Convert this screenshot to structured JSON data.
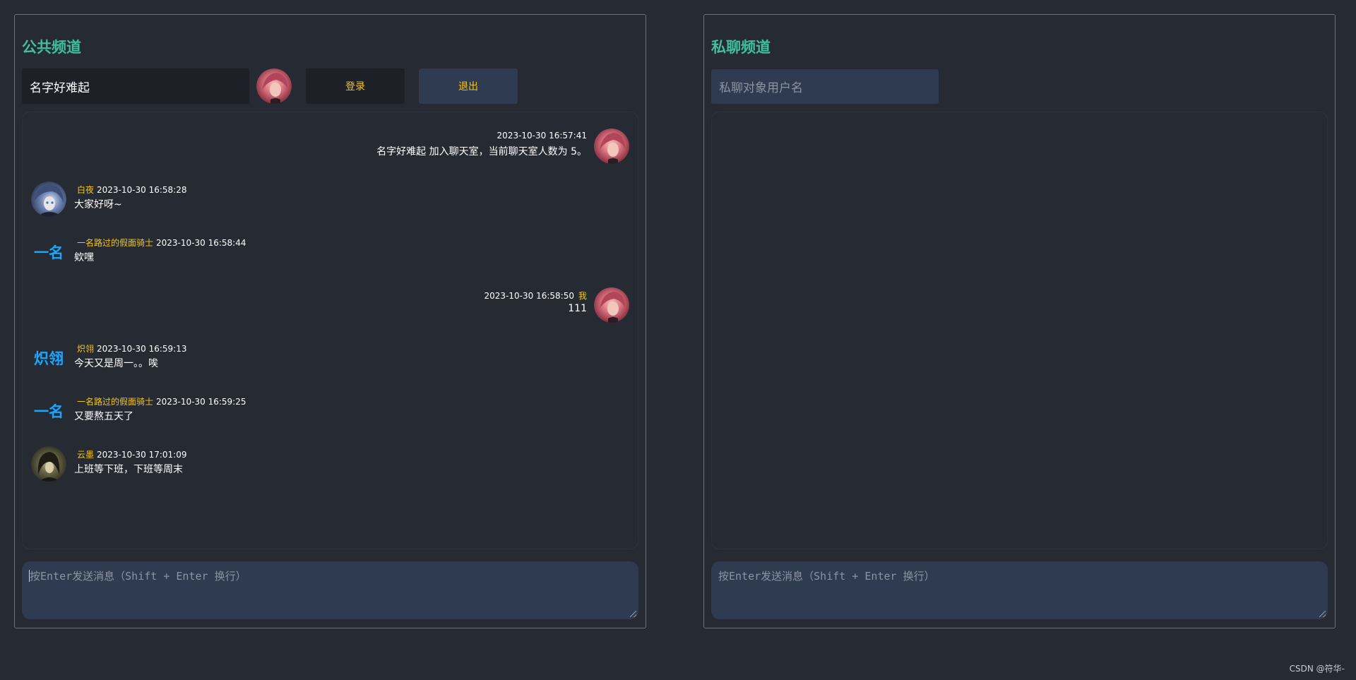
{
  "public": {
    "title": "公共频道",
    "username_value": "名字好难起",
    "login_label": "登录",
    "logout_label": "退出",
    "compose_placeholder": "按Enter发送消息（Shift + Enter 换行）",
    "messages": [
      {
        "side": "right",
        "avatar": "pink-hair-avatar",
        "user": "",
        "time": "2023-10-30 16:57:41",
        "text": "名字好难起 加入聊天室，当前聊天室人数为 5。"
      },
      {
        "side": "left",
        "avatar": "blue-hair-avatar",
        "user": "白夜",
        "time": "2023-10-30 16:58:28",
        "text": "大家好呀~"
      },
      {
        "side": "left",
        "avatar_text": "一名",
        "user": "一名路过的假面骑士",
        "time": "2023-10-30 16:58:44",
        "text": "欸嘿"
      },
      {
        "side": "right",
        "avatar": "pink-hair-avatar",
        "user": "我",
        "time": "2023-10-30 16:58:50",
        "text": "111"
      },
      {
        "side": "left",
        "avatar_text": "炽翎",
        "user": "炽翎",
        "time": "2023-10-30 16:59:13",
        "text": "今天又是周一。。唉"
      },
      {
        "side": "left",
        "avatar_text": "一名",
        "user": "一名路过的假面骑士",
        "time": "2023-10-30 16:59:25",
        "text": "又要熬五天了"
      },
      {
        "side": "left",
        "avatar": "dark-hair-avatar",
        "user": "云墨",
        "time": "2023-10-30 17:01:09",
        "text": "上班等下班，下班等周末"
      }
    ]
  },
  "private": {
    "title": "私聊频道",
    "target_placeholder": "私聊对象用户名",
    "compose_placeholder": "按Enter发送消息（Shift + Enter 换行）"
  },
  "watermark": "CSDN @符华-",
  "colors": {
    "background": "#262a33",
    "title": "#3fbf9c",
    "username": "#f5c518",
    "text_avatar": "#1aa6ff",
    "input_dark": "#1d2027",
    "input_blue": "#2f3b50"
  }
}
